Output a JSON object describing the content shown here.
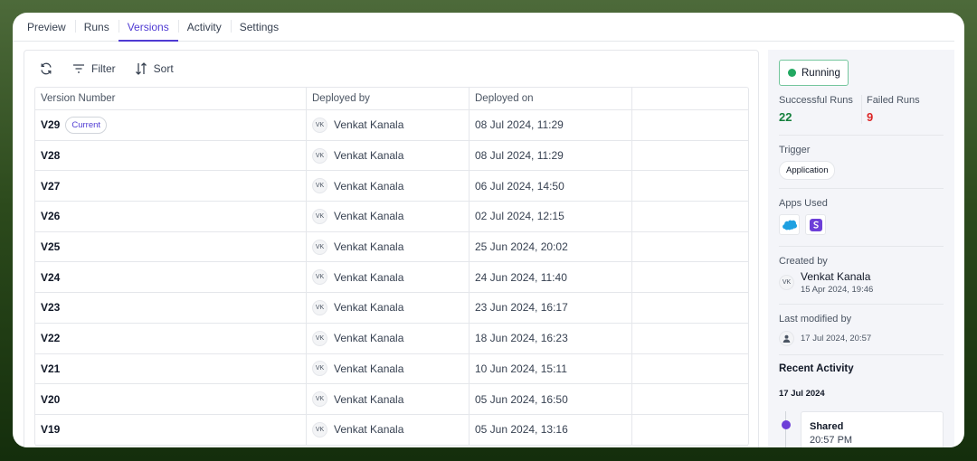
{
  "tabs": [
    {
      "label": "Preview"
    },
    {
      "label": "Runs"
    },
    {
      "label": "Versions"
    },
    {
      "label": "Activity"
    },
    {
      "label": "Settings"
    }
  ],
  "active_tab": "Versions",
  "toolbar": {
    "filter_label": "Filter",
    "sort_label": "Sort"
  },
  "table": {
    "headers": [
      "Version Number",
      "Deployed by",
      "Deployed on",
      ""
    ],
    "current_badge": "Current",
    "rows": [
      {
        "version": "V29",
        "initials": "VK",
        "deployed_by": "Venkat Kanala",
        "deployed_on": "08 Jul 2024, 11:29"
      },
      {
        "version": "V28",
        "initials": "VK",
        "deployed_by": "Venkat Kanala",
        "deployed_on": "08 Jul 2024, 11:29"
      },
      {
        "version": "V27",
        "initials": "VK",
        "deployed_by": "Venkat Kanala",
        "deployed_on": "06 Jul 2024, 14:50"
      },
      {
        "version": "V26",
        "initials": "VK",
        "deployed_by": "Venkat Kanala",
        "deployed_on": "02 Jul 2024, 12:15"
      },
      {
        "version": "V25",
        "initials": "VK",
        "deployed_by": "Venkat Kanala",
        "deployed_on": "25 Jun 2024, 20:02"
      },
      {
        "version": "V24",
        "initials": "VK",
        "deployed_by": "Venkat Kanala",
        "deployed_on": "24 Jun 2024, 11:40"
      },
      {
        "version": "V23",
        "initials": "VK",
        "deployed_by": "Venkat Kanala",
        "deployed_on": "23 Jun 2024, 16:17"
      },
      {
        "version": "V22",
        "initials": "VK",
        "deployed_by": "Venkat Kanala",
        "deployed_on": "18 Jun 2024, 16:23"
      },
      {
        "version": "V21",
        "initials": "VK",
        "deployed_by": "Venkat Kanala",
        "deployed_on": "10 Jun 2024, 15:11"
      },
      {
        "version": "V20",
        "initials": "VK",
        "deployed_by": "Venkat Kanala",
        "deployed_on": "05 Jun 2024, 16:50"
      },
      {
        "version": "V19",
        "initials": "VK",
        "deployed_by": "Venkat Kanala",
        "deployed_on": "05 Jun 2024, 13:16"
      }
    ]
  },
  "side": {
    "status": "Running",
    "successful_runs_label": "Successful Runs",
    "successful_runs": "22",
    "failed_runs_label": "Failed Runs",
    "failed_runs": "9",
    "trigger_label": "Trigger",
    "trigger_value": "Application",
    "apps_label": "Apps Used",
    "apps": [
      "salesforce-icon",
      "app-s-icon"
    ],
    "created_by_label": "Created by",
    "created_initials": "VK",
    "created_name": "Venkat Kanala",
    "created_date": "15 Apr 2024, 19:46",
    "modified_label": "Last modified by",
    "modified_date": "17 Jul 2024, 20:57",
    "recent_label": "Recent Activity",
    "recent_date": "17 Jul 2024",
    "event_title": "Shared",
    "event_time": "20:57 PM"
  },
  "colors": {
    "accent": "#4f3bd3",
    "success": "#15803d",
    "danger": "#dc2626",
    "running": "#22a861"
  }
}
